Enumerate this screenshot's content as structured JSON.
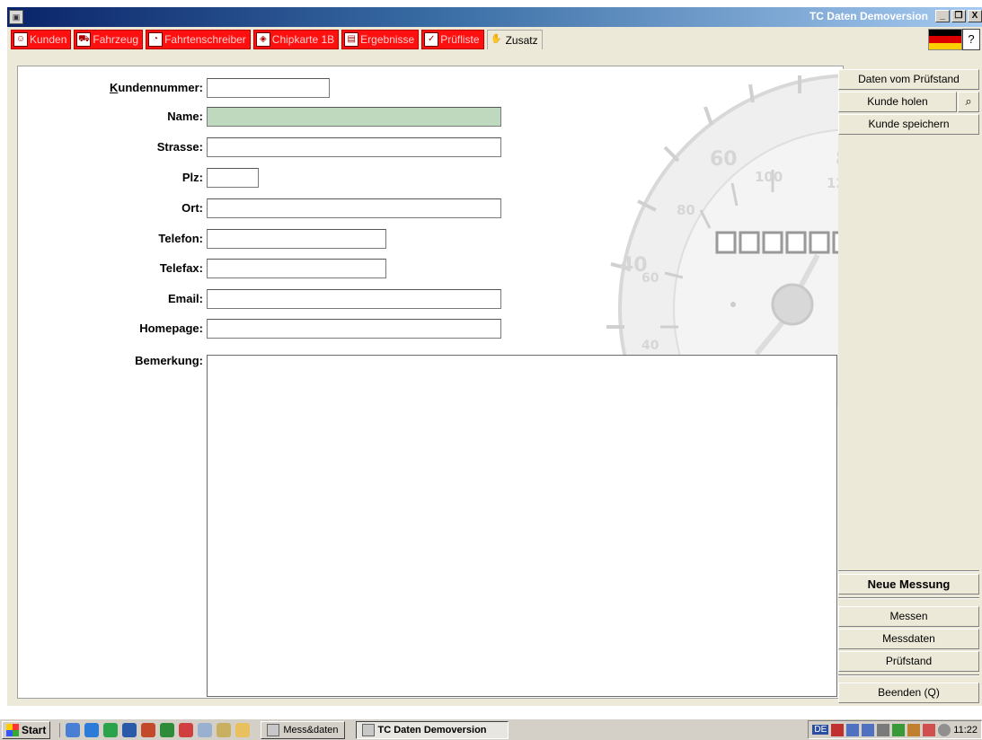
{
  "window": {
    "title": "TC Daten Demoversion",
    "controls": [
      "_",
      "❐",
      "X"
    ]
  },
  "tabs": [
    {
      "label": "Kunden",
      "icon": "people-icon",
      "active": true
    },
    {
      "label": "Fahrzeug",
      "icon": "car-icon"
    },
    {
      "label": "Fahrtenschreiber",
      "icon": "tachograph-icon"
    },
    {
      "label": "Chipkarte 1B",
      "icon": "chipcard-icon"
    },
    {
      "label": "Ergebnisse",
      "icon": "results-icon"
    },
    {
      "label": "Prüfliste",
      "icon": "checklist-icon"
    },
    {
      "label": "Zusatz",
      "icon": "hand-icon"
    }
  ],
  "help_label": "?",
  "form": {
    "kundennummer": {
      "label_u": "K",
      "label_rest": "undennummer:",
      "value": ""
    },
    "name": {
      "label": "Name:",
      "value": ""
    },
    "strasse": {
      "label": "Strasse:",
      "value": ""
    },
    "plz": {
      "label": "Plz:",
      "value": ""
    },
    "ort": {
      "label": "Ort:",
      "value": ""
    },
    "telefon": {
      "label": "Telefon:",
      "value": ""
    },
    "telefax": {
      "label": "Telefax:",
      "value": ""
    },
    "email": {
      "label": "Email:",
      "value": ""
    },
    "homepage": {
      "label": "Homepage:",
      "value": ""
    },
    "bemerkung": {
      "label": "Bemerkung:",
      "value": ""
    }
  },
  "speedometer": {
    "labels": [
      "60",
      "80",
      "100",
      "12",
      "80",
      "40",
      "60",
      "40"
    ]
  },
  "sidebar": {
    "daten_vom_pruefstand": "Daten vom Prüfstand",
    "kunde_holen": "Kunde holen",
    "kunde_speichern": "Kunde speichern",
    "neue_messung": "Neue Messung",
    "messen": "Messen",
    "messdaten": "Messdaten",
    "pruefstand": "Prüfstand",
    "beenden": "Beenden (Q)"
  },
  "taskbar": {
    "start": "Start",
    "tasks": [
      "Mess&daten",
      "TC Daten Demoversion"
    ],
    "tray_lang": "DE",
    "clock": "11:22"
  },
  "colors": {
    "tab_red": "#ff1010",
    "name_field": "#bfd9bf",
    "title_blue": "#0a246a"
  }
}
